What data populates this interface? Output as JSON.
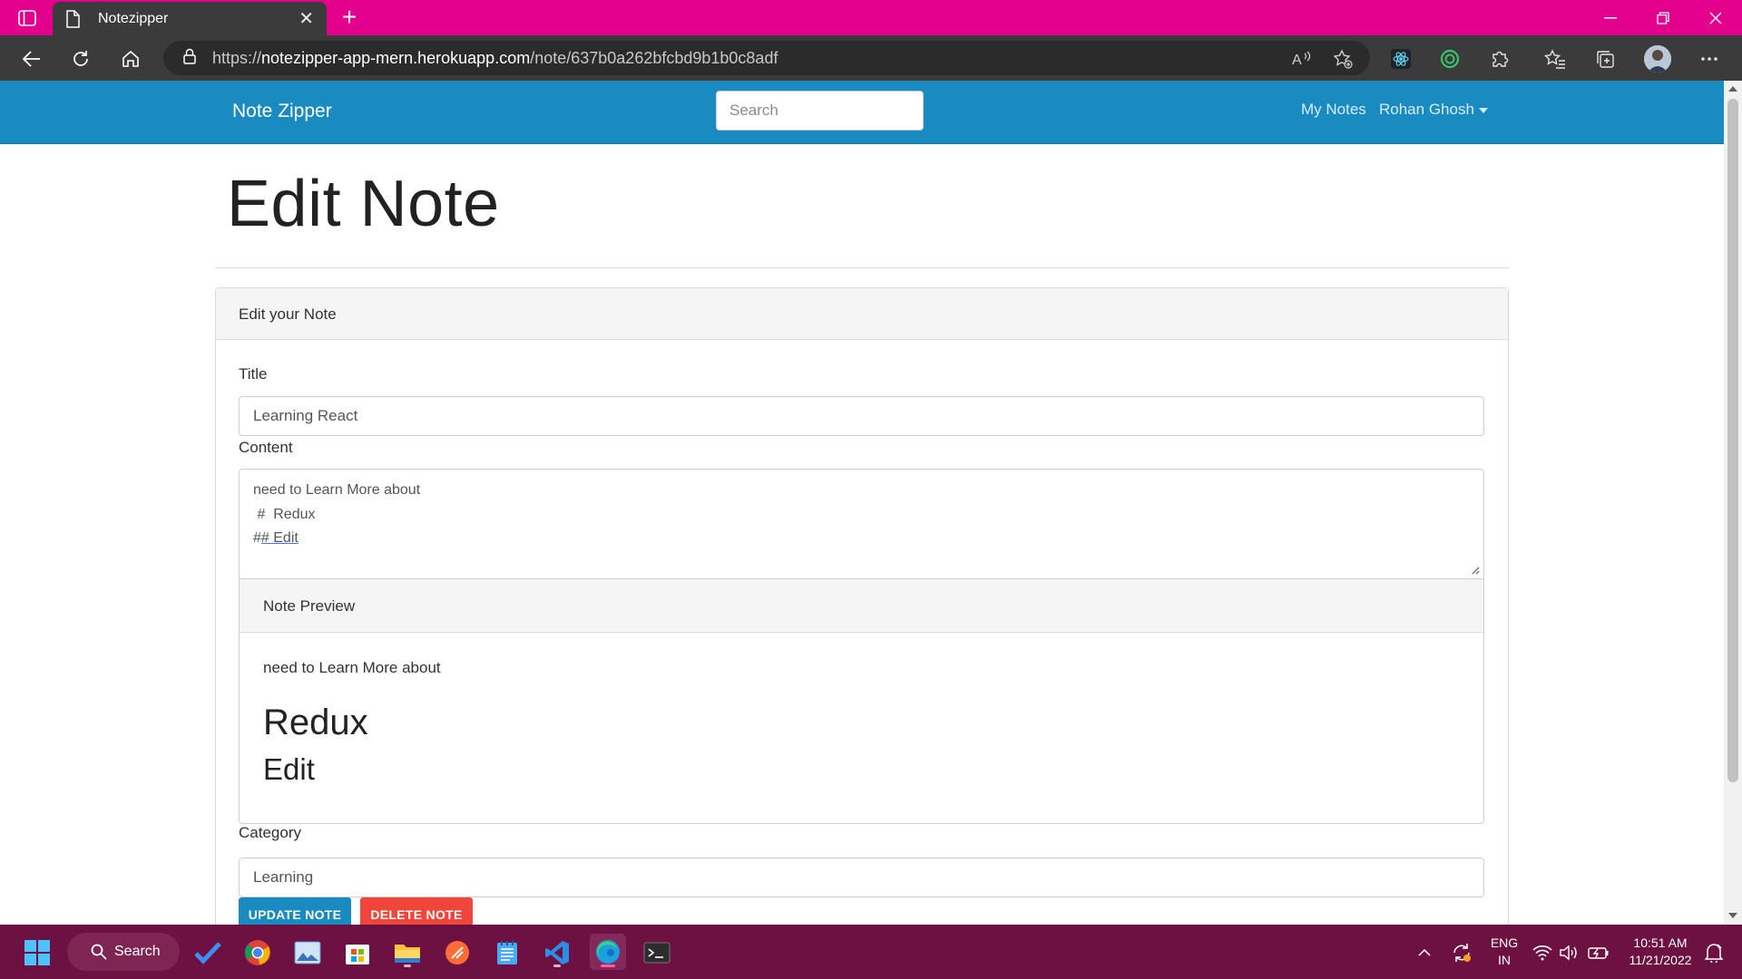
{
  "browser": {
    "tab_title": "Notezipper",
    "url_prefix": "https://",
    "url_host": "notezipper-app-mern.herokuapp.com",
    "url_path": "/note/637b0a262bfcbd9b1b0c8adf",
    "accent_color": "#e3008c"
  },
  "navbar": {
    "brand": "Note Zipper",
    "search_placeholder": "Search",
    "my_notes": "My Notes",
    "user_name": "Rohan Ghosh",
    "color": "#1a8bc0"
  },
  "page": {
    "title": "Edit Note",
    "card_header": "Edit your Note"
  },
  "form": {
    "title_label": "Title",
    "title_value": "Learning React",
    "content_label": "Content",
    "content_lines": {
      "l1": "need to Learn More about",
      "l2": " #  Redux",
      "l3_prefix": "#",
      "l3_underlined": "# Edit"
    },
    "preview_header": "Note Preview",
    "preview": {
      "paragraph": "need to Learn More about",
      "h1": "Redux",
      "h2": "Edit"
    },
    "category_label": "Category",
    "category_value": "Learning",
    "update_button": "UPDATE NOTE",
    "delete_button": "DELETE NOTE"
  },
  "taskbar": {
    "search_label": "Search",
    "lang_line1": "ENG",
    "lang_line2": "IN",
    "time": "10:51 AM",
    "date": "11/21/2022"
  }
}
